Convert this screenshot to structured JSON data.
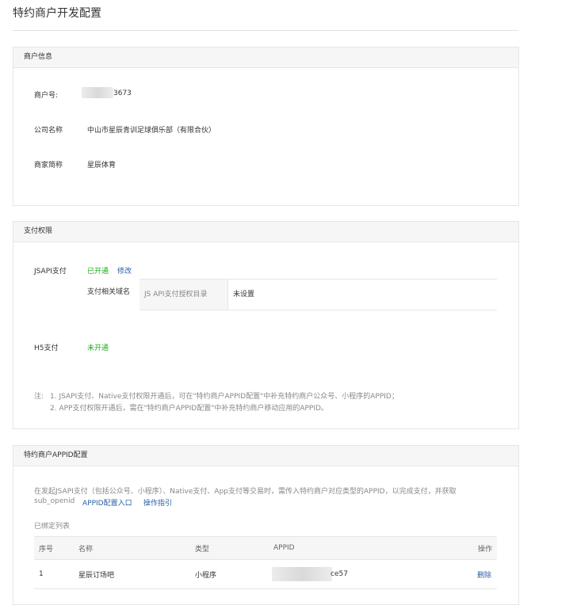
{
  "page": {
    "title": "特约商户开发配置"
  },
  "merchant_info": {
    "heading": "商户信息",
    "rows": [
      {
        "label": "商户号:",
        "value": "3673"
      },
      {
        "label": "公司名称",
        "value": "中山市星辰青训足球俱乐部（有限合伙）"
      },
      {
        "label": "商家简称",
        "value": "星辰体育"
      }
    ]
  },
  "payment": {
    "heading": "支付权限",
    "jsapi": {
      "label": "JSAPI支付",
      "status": "已开通",
      "modify": "修改",
      "domain_label": "支付相关域名",
      "domain_table": {
        "header": "JS API支付授权目录",
        "value": "未设置"
      }
    },
    "h5": {
      "label": "H5支付",
      "status": "未开通"
    },
    "notes": {
      "prefix": "注:",
      "line1": "1. JSAPI支付、Native支付权限开通后，可在\"特约商户APPID配置\"中补充特约商户公众号、小程序的APPID；",
      "line2": "2. APP支付权限开通后，需在\"特约商户APPID配置\"中补充特约商户移动应用的APPID。"
    }
  },
  "appid_config": {
    "heading": "特约商户APPID配置",
    "desc_line1": "在发起JSAPI支付（包括公众号、小程序）、Native支付、App支付等交易时，需传入特约商户对应类型的APPID，以完成支付，并获取",
    "desc_line2": "sub_openid",
    "link_entry": "APPID配置入口",
    "link_guide": "操作指引",
    "bound_title": "已绑定列表",
    "columns": [
      "序号",
      "名称",
      "类型",
      "APPID",
      "操作"
    ],
    "rows": [
      {
        "index": "1",
        "name": "星辰订场吧",
        "type": "小程序",
        "appid_visible": "ce57",
        "action": "删除"
      }
    ]
  }
}
